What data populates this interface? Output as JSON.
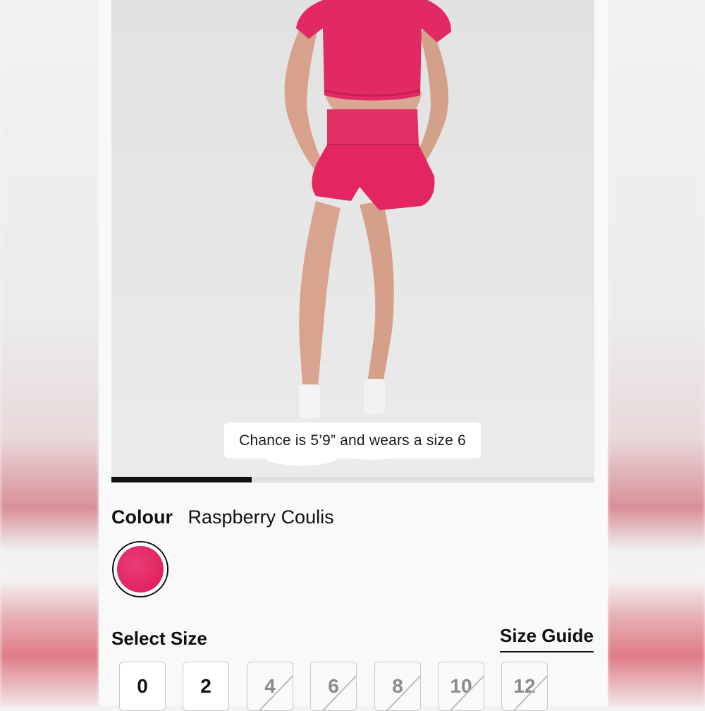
{
  "product": {
    "caption": "Chance is 5’9” and wears a size 6",
    "gallery_progress": 0.29
  },
  "colour": {
    "label": "Colour",
    "value": "Raspberry Coulis",
    "swatch_color": "#e12a63"
  },
  "size": {
    "label": "Select Size",
    "guide_label": "Size Guide",
    "options": [
      {
        "label": "0",
        "available": true
      },
      {
        "label": "2",
        "available": true
      },
      {
        "label": "4",
        "available": false
      },
      {
        "label": "6",
        "available": false
      },
      {
        "label": "8",
        "available": false
      },
      {
        "label": "10",
        "available": false
      },
      {
        "label": "12",
        "available": false
      }
    ]
  }
}
